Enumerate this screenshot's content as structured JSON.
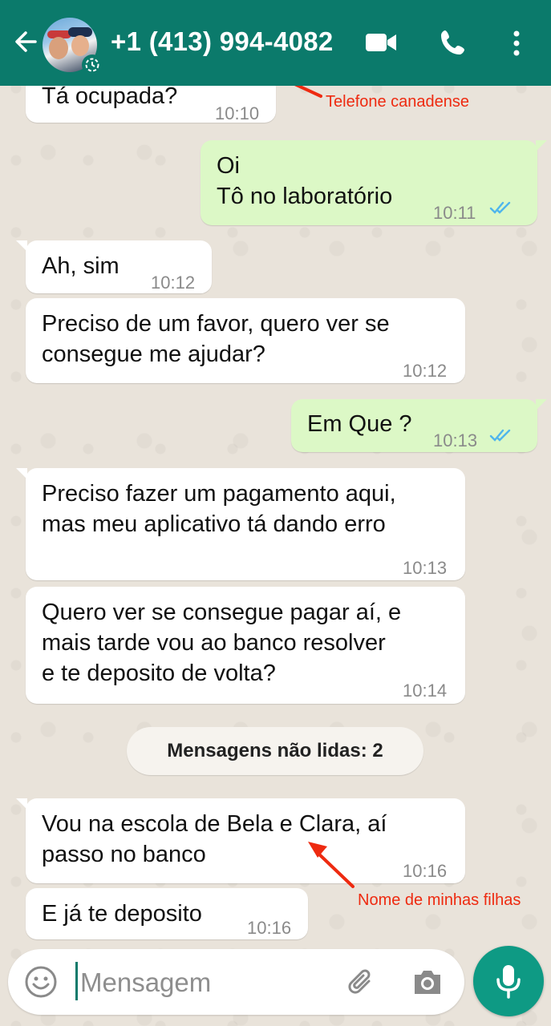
{
  "header": {
    "contact_name": "+1 (413) 994-4082",
    "color": "#0b7a6b"
  },
  "messages": [
    {
      "direction": "in",
      "text": "Tá ocupada?",
      "time": "10:10"
    },
    {
      "direction": "out",
      "text": "Oi\nTô no laboratório",
      "time": "10:11",
      "status": "read"
    },
    {
      "direction": "in",
      "text": "Ah, sim",
      "time": "10:12"
    },
    {
      "direction": "in",
      "text": "Preciso de um favor, quero ver se\nconsegue me ajudar?",
      "time": "10:12"
    },
    {
      "direction": "out",
      "text": "Em Que ?",
      "time": "10:13",
      "status": "read"
    },
    {
      "direction": "in",
      "text": "Preciso fazer um pagamento aqui,\nmas meu aplicativo tá dando erro",
      "time": "10:13"
    },
    {
      "direction": "in",
      "text": "Quero ver se consegue pagar aí, e\nmais tarde vou ao banco resolver\ne te deposito de volta?",
      "time": "10:14"
    },
    {
      "direction": "in",
      "text": "Vou na escola de Bela  e Clara, aí\npasso no banco",
      "time": "10:16"
    },
    {
      "direction": "in",
      "text": "E já te deposito",
      "time": "10:16"
    }
  ],
  "unread_banner": "Mensagens não lidas: 2",
  "annotations": {
    "phone": "Telefone canadense",
    "names": "Nome de minhas filhas",
    "color": "#ee2a10"
  },
  "composer": {
    "placeholder": "Mensagem",
    "icons": [
      "emoji-icon",
      "paperclip-icon",
      "camera-icon",
      "microphone-icon"
    ]
  }
}
